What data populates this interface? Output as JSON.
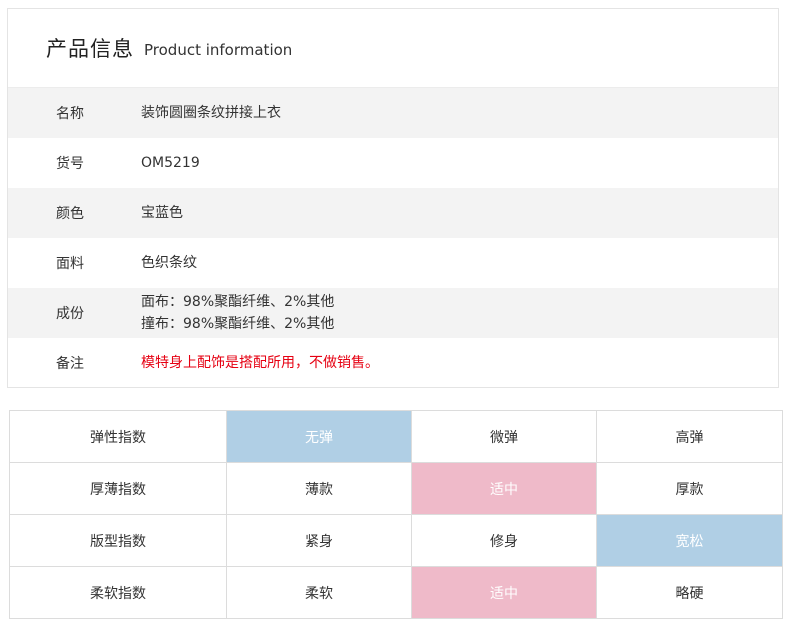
{
  "product_info": {
    "title_cn": "产品信息",
    "title_en": "Product information",
    "rows": [
      {
        "label": "名称",
        "value": "装饰圆圈条纹拼接上衣"
      },
      {
        "label": "货号",
        "value": "OM5219"
      },
      {
        "label": "颜色",
        "value": "宝蓝色"
      },
      {
        "label": "面料",
        "value": "色织条纹"
      },
      {
        "label": "成份",
        "value_lines": [
          "面布：98%聚酯纤维、2%其他",
          "撞布：98%聚酯纤维、2%其他"
        ]
      },
      {
        "label": "备注",
        "value": "模特身上配饰是搭配所用，不做销售。",
        "color": "#e60012"
      }
    ]
  },
  "index_table": {
    "rows": [
      {
        "label": "弹性指数",
        "options": [
          "无弹",
          "微弹",
          "高弹"
        ],
        "selected": "无弹",
        "highlight": "#b0cfe5"
      },
      {
        "label": "厚薄指数",
        "options": [
          "薄款",
          "适中",
          "厚款"
        ],
        "selected": "适中",
        "highlight": "#efbac9"
      },
      {
        "label": "版型指数",
        "options": [
          "紧身",
          "修身",
          "宽松"
        ],
        "selected": "宽松",
        "highlight": "#b0cfe5"
      },
      {
        "label": "柔软指数",
        "options": [
          "柔软",
          "适中",
          "略硬"
        ],
        "selected": "适中",
        "highlight": "#efbac9"
      }
    ]
  }
}
